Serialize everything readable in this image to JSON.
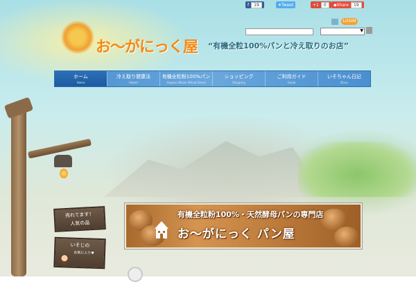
{
  "social": {
    "facebook_count": "19",
    "tweet_label": "Tweet",
    "gplus_label": "+1",
    "gplus_count": "0",
    "share_label": "Share",
    "share_count": "19"
  },
  "header": {
    "login_label": "LOGIN",
    "brand": "お〜がにっく屋",
    "tagline": "“有機全粒100%パンと冷え取りのお店”"
  },
  "nav": {
    "items": [
      {
        "label": "ホーム",
        "sub": "Home"
      },
      {
        "label": "冷え取り健康法",
        "sub": "Hietori"
      },
      {
        "label": "有機全粒粉100%パン",
        "sub": "Organic Whole Wheat Bread"
      },
      {
        "label": "ショッピング",
        "sub": "Shopping"
      },
      {
        "label": "ご利用ガイド",
        "sub": "Guide"
      },
      {
        "label": "いそちゃん日記",
        "sub": "Diary"
      }
    ]
  },
  "signs": {
    "sign1_line1": "売れてます！",
    "sign1_line2": "人気の品",
    "sign2_line1": "いそじの",
    "sign2_line2": "お気に入り♥"
  },
  "banner": {
    "top_text": "有機全粒粉100%・天然酵母パンの専門店",
    "main_text": "お〜がにっく パン屋"
  }
}
